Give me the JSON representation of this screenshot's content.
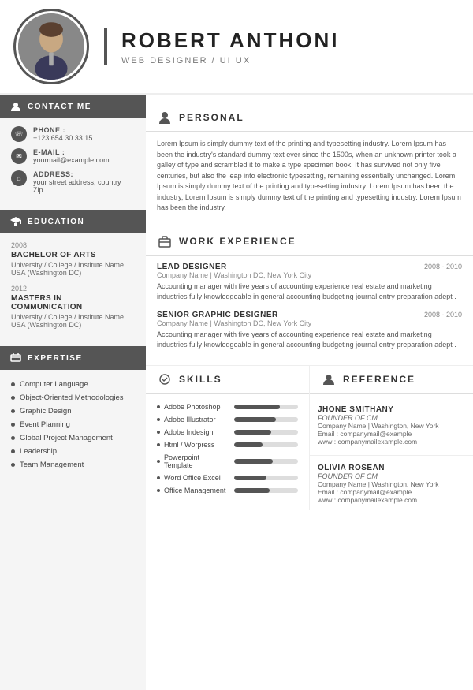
{
  "header": {
    "name": "ROBERT ANTHONI",
    "title": "WEB DESIGNER / UI UX"
  },
  "contact": {
    "section_label": "CONTACT ME",
    "phone_label": "PHONE :",
    "phone_value": "+123 654 30 33 15",
    "email_label": "E-MAIL :",
    "email_value": "yourmail@example.com",
    "address_label": "ADDRESS:",
    "address_value": "your street address, country Zip."
  },
  "education": {
    "section_label": "EDUCATION",
    "items": [
      {
        "year": "2008",
        "degree": "BACHELOR OF ARTS",
        "school": "University / College / Institute Name",
        "location": "USA (Washington DC)"
      },
      {
        "year": "2012",
        "degree": "MASTERS IN COMMUNICATION",
        "school": "University / College / Institute Name",
        "location": "USA (Washington DC)"
      }
    ]
  },
  "expertise": {
    "section_label": "EXPERTISE",
    "items": [
      "Computer Language",
      "Object-Oriented Methodologies",
      "Graphic Design",
      "Event Planning",
      "Global Project Management",
      "Leadership",
      "Team Management"
    ]
  },
  "personal": {
    "section_label": "PERSONAL",
    "text": "Lorem Ipsum is simply dummy text of the printing and typesetting industry. Lorem Ipsum has been the industry's standard dummy text ever since the 1500s, when an unknown printer took a galley of type and scrambled it to make a type specimen book. It has survived not only five centuries, but also the leap into electronic typesetting, remaining essentially unchanged. Lorem Ipsum is simply dummy text of the printing and typesetting industry. Lorem Ipsum has been the industry, Lorem Ipsum is simply dummy text of the printing and typesetting industry. Lorem Ipsum has been the industry."
  },
  "work_experience": {
    "section_label": "WORK EXPERIENCE",
    "items": [
      {
        "title": "LEAD DESIGNER",
        "company": "Company Name  |  Washington DC, New York City",
        "years": "2008 - 2010",
        "description": "Accounting manager with five years of accounting experience real estate and marketing industries fully knowledgeable in general accounting budgeting journal entry preparation adept ."
      },
      {
        "title": "SENIOR GRAPHIC DESIGNER",
        "company": "Company Name  |  Washington DC, New York City",
        "years": "2008 - 2010",
        "description": "Accounting manager with five years of accounting experience real estate and marketing industries fully knowledgeable in general accounting budgeting journal entry preparation adept ."
      }
    ]
  },
  "skills": {
    "section_label": "SKILLS",
    "items": [
      {
        "label": "Adobe Photoshop",
        "pct": 72
      },
      {
        "label": "Adobe Illustrator",
        "pct": 65
      },
      {
        "label": "Adobe Indesign",
        "pct": 58
      },
      {
        "label": "Html / Worpress",
        "pct": 45
      },
      {
        "label": "Powerpoint Template",
        "pct": 60
      },
      {
        "label": "Word Office Excel",
        "pct": 50
      },
      {
        "label": "Office Management",
        "pct": 55
      }
    ]
  },
  "references": {
    "section_label": "REFERENCE",
    "items": [
      {
        "name": "JHONE SMITHANY",
        "role": "FOUNDER OF CM",
        "company": "Company Name  |  Washington, New York",
        "email": "Email : companymail@example",
        "website": "www : companymailexample.com"
      },
      {
        "name": "OLIVIA ROSEAN",
        "role": "FOUNDER OF CM",
        "company": "Company Name  |  Washington, New York",
        "email": "Email : companymail@example",
        "website": "www : companymailexample.com"
      }
    ]
  }
}
